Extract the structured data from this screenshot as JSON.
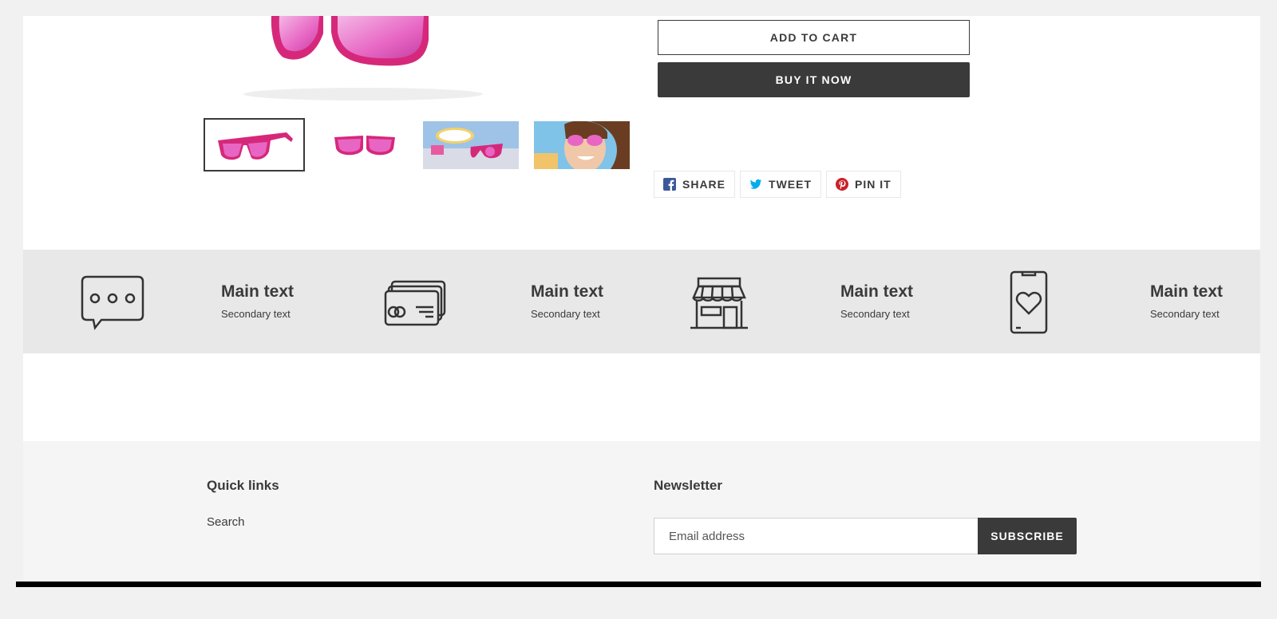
{
  "product": {
    "main_image_alt": "Pink sunglasses",
    "thumbnails": [
      {
        "alt": "Pink sunglasses side view",
        "active": true
      },
      {
        "alt": "Pink sunglasses front view",
        "active": false
      },
      {
        "alt": "Sunglasses in Las Vegas",
        "active": false
      },
      {
        "alt": "Woman wearing pink sunglasses",
        "active": false
      }
    ],
    "add_to_cart_label": "ADD TO CART",
    "buy_now_label": "BUY IT NOW",
    "social": {
      "share_label": "SHARE",
      "tweet_label": "TWEET",
      "pin_label": "PIN IT"
    },
    "colors": {
      "frame_pink": "#d6287a",
      "lens_pink": "#e766c3",
      "facebook": "#3b5998",
      "twitter": "#00aced",
      "pinterest": "#cb2027"
    }
  },
  "features": [
    {
      "icon": "chat-bubble-icon",
      "title": "Main text",
      "subtitle": "Secondary text"
    },
    {
      "icon": "credit-card-icon",
      "title": "Main text",
      "subtitle": "Secondary text"
    },
    {
      "icon": "store-icon",
      "title": "Main text",
      "subtitle": "Secondary text"
    },
    {
      "icon": "phone-heart-icon",
      "title": "Main text",
      "subtitle": "Secondary text"
    }
  ],
  "footer": {
    "quick_links_title": "Quick links",
    "quick_links": [
      {
        "label": "Search"
      }
    ],
    "newsletter_title": "Newsletter",
    "email_placeholder": "Email address",
    "subscribe_label": "SUBSCRIBE"
  }
}
